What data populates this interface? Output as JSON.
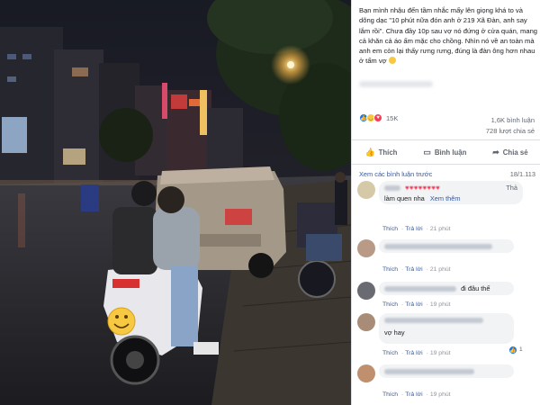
{
  "post": {
    "caption": "Bạn mình nhậu đến tầm nhắc mấy lên giọng khá to và dõng dạc \"10 phút nữa đón anh ở 219 Xã Đàn, anh say lắm rồi\". Chưa đầy 10p sau vợ nó đứng ở cửa quán, mang cả khăn cả áo ấm mặc cho chồng. Nhìn nó về an toàn mà anh em còn lại thấy rưng rưng, đúng là đàn ông hơn nhau ở tấm vợ",
    "reaction_count": "15K",
    "comment_count": "1,6K bình luận",
    "share_count": "728 lượt chia sẻ"
  },
  "actions": {
    "like": "Thích",
    "comment": "Bình luận",
    "share": "Chia sẻ"
  },
  "comments_header": {
    "previous": "Xem các bình luận trước",
    "count": "18/1.113"
  },
  "comments": [
    {
      "text_prefix": "",
      "hearts": "♥♥♥♥♥♥♥♥",
      "trail": "Thả",
      "line2": "làm quen nha",
      "see_more": "Xem thêm",
      "like": "Thích",
      "reply": "Trả lời",
      "time": "21 phút"
    },
    {
      "like": "Thích",
      "reply": "Trả lời",
      "time": "21 phút"
    },
    {
      "trail": "đi đâu thế",
      "like": "Thích",
      "reply": "Trả lời",
      "time": "19 phút"
    },
    {
      "trail": "vợ hay",
      "reply_badge": "1",
      "like": "Thích",
      "reply": "Trả lời",
      "time": "19 phút"
    },
    {
      "like": "Thích",
      "reply": "Trả lời",
      "time": "19 phút"
    }
  ],
  "icons": {
    "like": "thumbs-up-icon",
    "comment": "speech-bubble-icon",
    "share": "share-arrow-icon"
  },
  "colors": {
    "link": "#385898",
    "like_blue": "#1877f2",
    "love_red": "#f33e58",
    "haha_yellow": "#f7c841"
  }
}
